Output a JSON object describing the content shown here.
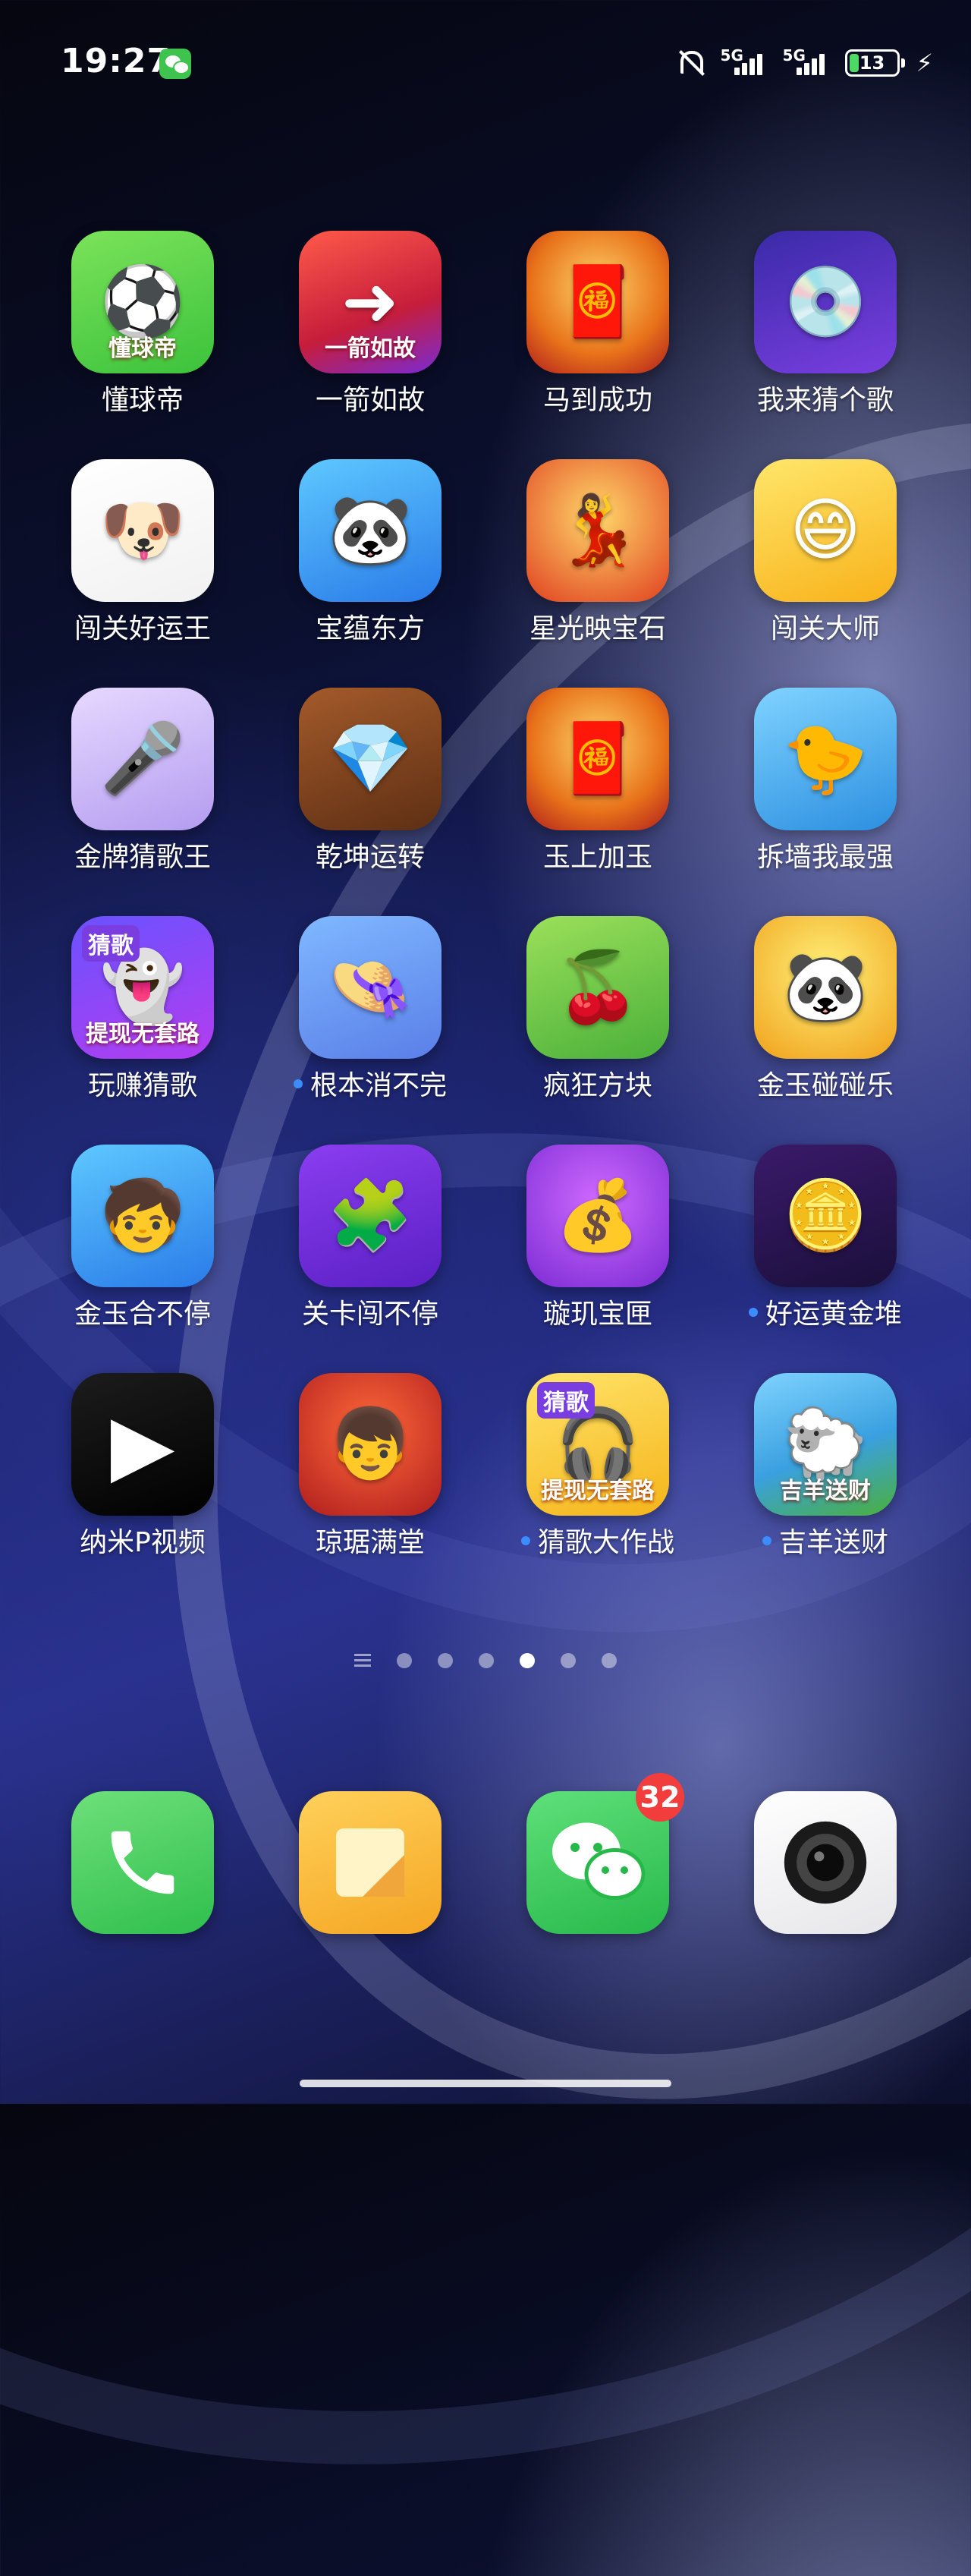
{
  "status": {
    "time": "19:27",
    "signal1": "5G",
    "signal2": "5G",
    "battery": "13",
    "charging_glyph": "⚡"
  },
  "apps": [
    {
      "label": "懂球帝",
      "icon": "soccer-ball-icon",
      "caption": "懂球帝",
      "dot": false
    },
    {
      "label": "一箭如故",
      "icon": "arrow-game-icon",
      "caption": "一箭如故",
      "dot": false
    },
    {
      "label": "马到成功",
      "icon": "fortune-god-icon",
      "caption": "",
      "dot": false
    },
    {
      "label": "我来猜个歌",
      "icon": "vinyl-record-icon",
      "caption": "",
      "dot": false
    },
    {
      "label": "闯关好运王",
      "icon": "doge-heart-icon",
      "caption": "",
      "dot": false
    },
    {
      "label": "宝蕴东方",
      "icon": "panda-mahjong-icon",
      "caption": "",
      "dot": false
    },
    {
      "label": "星光映宝石",
      "icon": "flamenco-girl-icon",
      "caption": "",
      "dot": false
    },
    {
      "label": "闯关大师",
      "icon": "yellow-blob-icon",
      "caption": "",
      "dot": false
    },
    {
      "label": "金牌猜歌王",
      "icon": "singer-girl-icon",
      "caption": "",
      "dot": false
    },
    {
      "label": "乾坤运转",
      "icon": "gem-blocks-icon",
      "caption": "",
      "dot": false
    },
    {
      "label": "玉上加玉",
      "icon": "fortune-god-icon",
      "caption": "",
      "dot": false
    },
    {
      "label": "拆墙我最强",
      "icon": "peashooter-icon",
      "caption": "",
      "dot": false
    },
    {
      "label": "玩赚猜歌",
      "icon": "ghost-music-icon",
      "caption": "提现无套路",
      "capTop": "猜歌",
      "dot": false
    },
    {
      "label": "根本消不完",
      "icon": "girl-hat-icon",
      "caption": "",
      "dot": true
    },
    {
      "label": "疯狂方块",
      "icon": "cherry-tiles-icon",
      "caption": "",
      "dot": false
    },
    {
      "label": "金玉碰碰乐",
      "icon": "panda-gold-icon",
      "caption": "",
      "dot": false
    },
    {
      "label": "金玉合不停",
      "icon": "boy-gold-icon",
      "caption": "",
      "dot": false
    },
    {
      "label": "关卡闯不停",
      "icon": "puzzle-tiles-icon",
      "caption": "",
      "dot": false
    },
    {
      "label": "璇玑宝匣",
      "icon": "treasure-chest-icon",
      "caption": "",
      "dot": false
    },
    {
      "label": "好运黄金堆",
      "icon": "fortune-coins-icon",
      "caption": "",
      "dot": true
    },
    {
      "label": "纳米P视频",
      "icon": "play-p-icon",
      "caption": "",
      "dot": false
    },
    {
      "label": "琼琚满堂",
      "icon": "boy-ingot-icon",
      "caption": "",
      "dot": false
    },
    {
      "label": "猜歌大作战",
      "icon": "headphones-icon",
      "caption": "提现无套路",
      "capTop": "猜歌",
      "dot": true
    },
    {
      "label": "吉羊送财",
      "icon": "sheep-icon",
      "caption": "吉羊送财",
      "dot": true
    }
  ],
  "pager": {
    "count": 6,
    "active": 3
  },
  "dock": [
    {
      "name": "phone",
      "icon": "phone-icon"
    },
    {
      "name": "notes",
      "icon": "notes-icon"
    },
    {
      "name": "wechat",
      "icon": "wechat-icon",
      "badge": "32"
    },
    {
      "name": "camera",
      "icon": "camera-icon"
    }
  ]
}
